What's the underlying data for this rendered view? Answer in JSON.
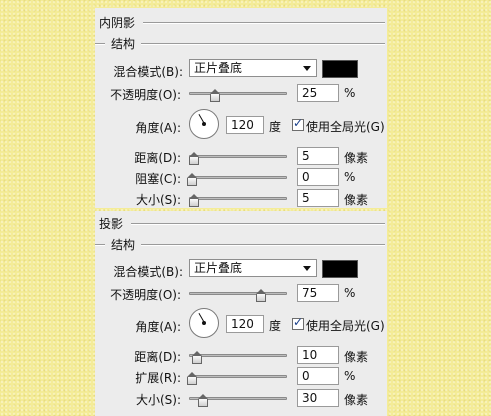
{
  "inner_shadow": {
    "title": "内阴影",
    "structure": "结构",
    "blend_label": "混合模式(B):",
    "blend_value": "正片叠底",
    "blend_color": "#000000",
    "opacity_label": "不透明度(O):",
    "opacity_value": "25",
    "opacity_unit": "%",
    "opacity_fraction": 0.25,
    "angle_label": "角度(A):",
    "angle_value": "120",
    "angle_unit": "度",
    "global_light_label": "使用全局光(G)",
    "global_light_checked": true,
    "global_light_mark": "✓",
    "distance_label": "距离(D):",
    "distance_value": "5",
    "distance_unit": "像素",
    "distance_fraction": 0.02,
    "choke_label": "阻塞(C):",
    "choke_value": "0",
    "choke_unit": "%",
    "choke_fraction": 0.0,
    "size_label": "大小(S):",
    "size_value": "5",
    "size_unit": "像素",
    "size_fraction": 0.02
  },
  "drop_shadow": {
    "title": "投影",
    "structure": "结构",
    "blend_label": "混合模式(B):",
    "blend_value": "正片叠底",
    "blend_color": "#000000",
    "opacity_label": "不透明度(O):",
    "opacity_value": "75",
    "opacity_unit": "%",
    "opacity_fraction": 0.75,
    "angle_label": "角度(A):",
    "angle_value": "120",
    "angle_unit": "度",
    "global_light_label": "使用全局光(G)",
    "global_light_checked": true,
    "global_light_mark": "✓",
    "distance_label": "距离(D):",
    "distance_value": "10",
    "distance_unit": "像素",
    "distance_fraction": 0.05,
    "spread_label": "扩展(R):",
    "spread_value": "0",
    "spread_unit": "%",
    "spread_fraction": 0.0,
    "size_label": "大小(S):",
    "size_value": "30",
    "size_unit": "像素",
    "size_fraction": 0.12
  }
}
